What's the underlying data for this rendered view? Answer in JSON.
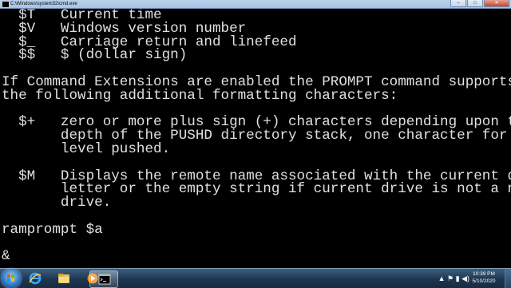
{
  "window": {
    "title": "C:\\Windows\\system32\\cmd.exe",
    "minimize": "–",
    "maximize": "□",
    "close": "✕"
  },
  "console": {
    "lines": [
      "  $T   Current time",
      "  $V   Windows version number",
      "  $_   Carriage return and linefeed",
      "  $$   $ (dollar sign)",
      "",
      "If Command Extensions are enabled the PROMPT command supports",
      "the following additional formatting characters:",
      "",
      "  $+   zero or more plus sign (+) characters depending upon the",
      "       depth of the PUSHD directory stack, one character for each",
      "       level pushed.",
      "",
      "  $M   Displays the remote name associated with the current drive",
      "       letter or the empty string if current drive is not a network",
      "       drive.",
      "",
      "ramprompt $a",
      "",
      "&"
    ]
  },
  "taskbar": {
    "items": [
      {
        "name": "internet-explorer",
        "active": false
      },
      {
        "name": "windows-explorer",
        "active": false
      },
      {
        "name": "media-player",
        "active": false
      },
      {
        "name": "command-prompt",
        "active": true
      }
    ],
    "clock_time": "10:39 PM",
    "clock_date": "5/10/2020",
    "colors": {
      "taskbar_top": "#3d5f7f",
      "taskbar_bottom": "#172b42",
      "console_bg": "#000000",
      "console_fg": "#e0e0e0"
    }
  }
}
